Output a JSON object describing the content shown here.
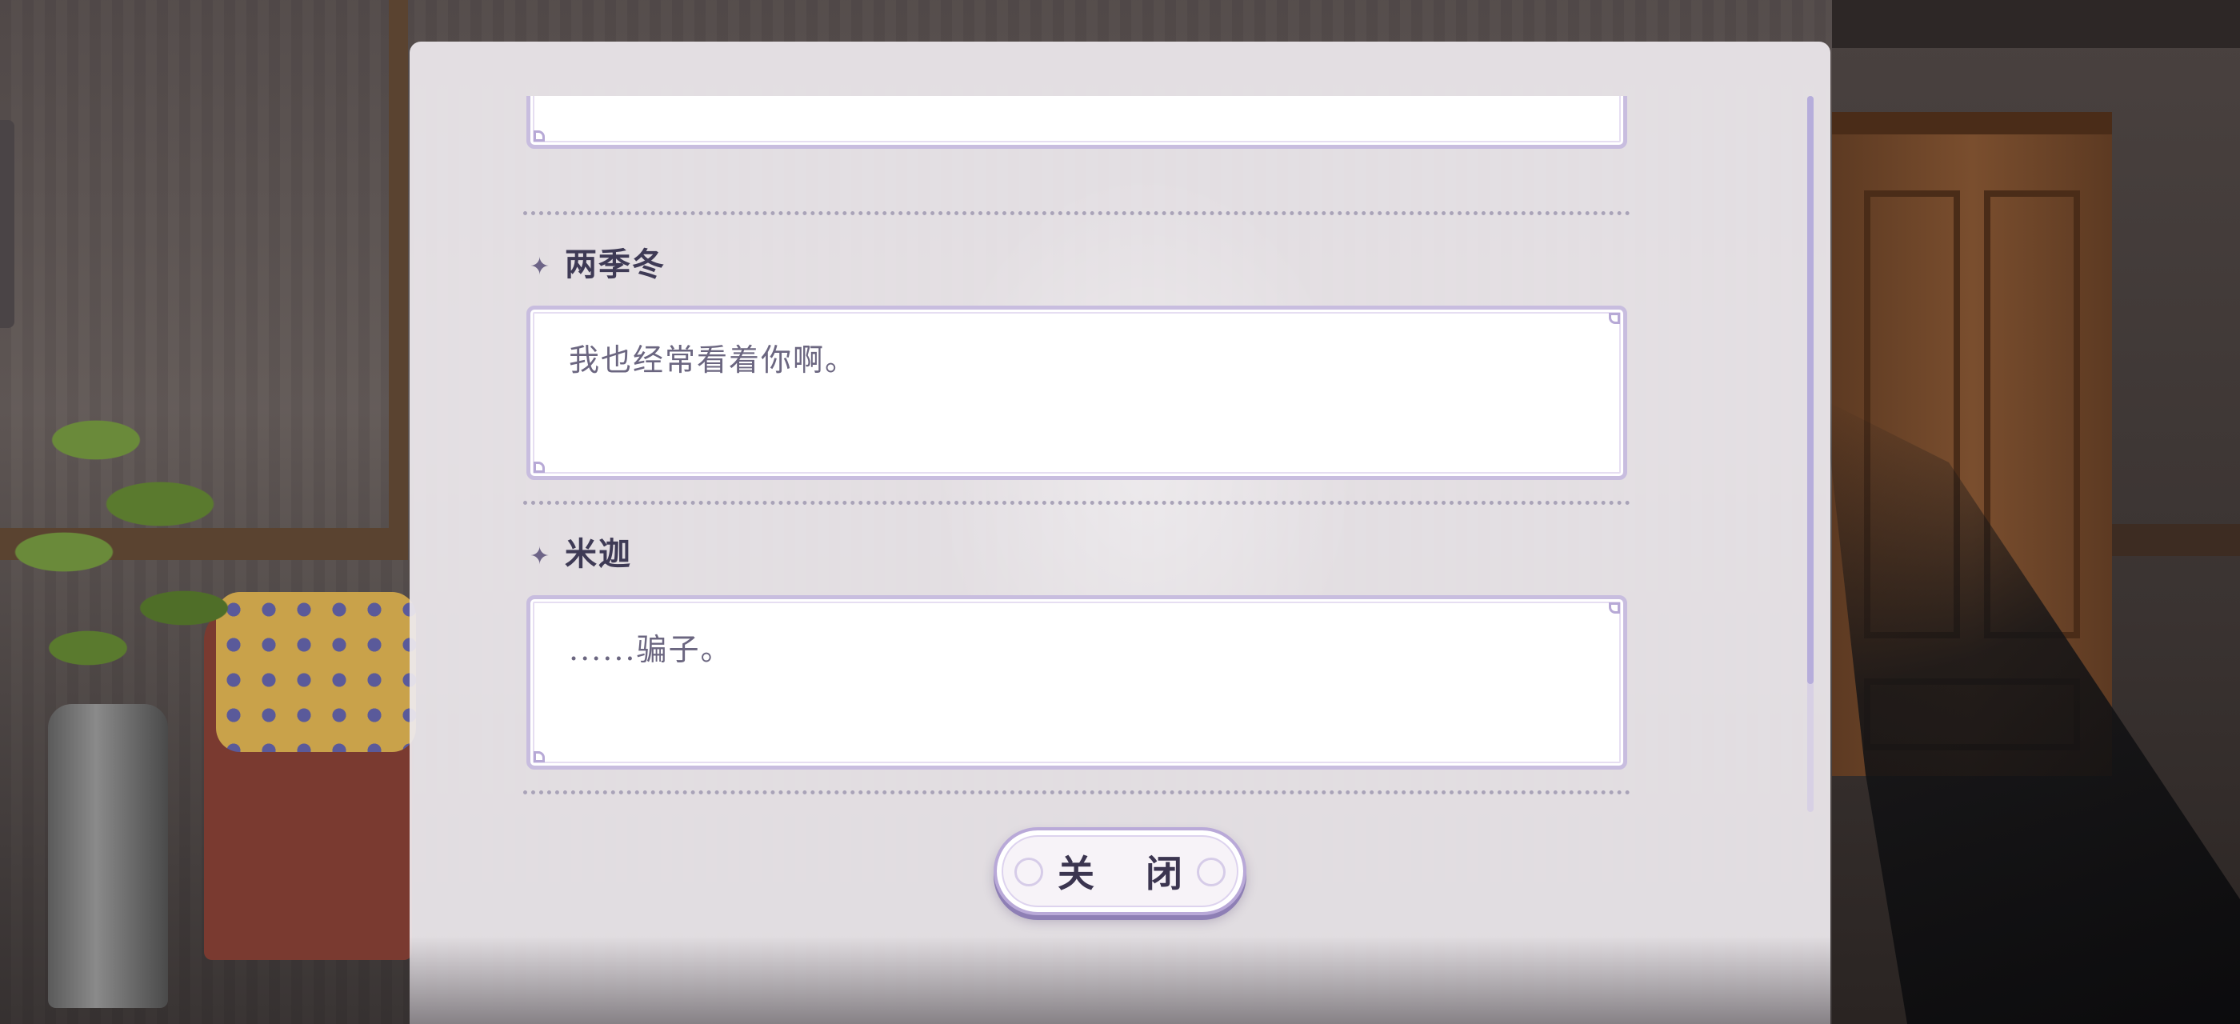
{
  "dialog_log": {
    "entries": [
      {
        "speaker": "两季冬",
        "text": "我也经常看着你啊。"
      },
      {
        "speaker": "米迦",
        "text": "......骗子。"
      }
    ],
    "close_label": "关 闭",
    "scroll_position": 0.82
  },
  "icons": {
    "speaker_marker": "four-point-star-icon"
  },
  "colors": {
    "panel_bg": "#eee9ee",
    "box_border": "#c8bddf",
    "speaker_name": "#3e3a55",
    "message_text": "#6b6680",
    "scroll_thumb": "#b6addb"
  }
}
